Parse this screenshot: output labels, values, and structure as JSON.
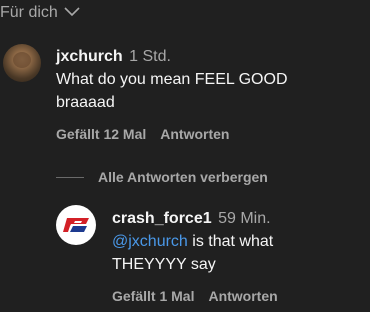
{
  "filter": {
    "label": "Für dich",
    "icon": "chevron-down-icon"
  },
  "comments": [
    {
      "username": "jxchurch",
      "time": "1 Std.",
      "text": "What do you mean FEEL GOOD braaaad",
      "likes_label": "Gefällt 12 Mal",
      "reply_label": "Antworten"
    }
  ],
  "replies_toggle": {
    "label": "Alle Antworten verbergen"
  },
  "replies": [
    {
      "username": "crash_force1",
      "time": "59 Min.",
      "mention": "@jxchurch",
      "text": "is that what THEYYYY say",
      "likes_label": "Gefällt 1 Mal",
      "reply_label": "Antworten"
    }
  ],
  "colors": {
    "background": "#202020",
    "mention": "#4a98e8",
    "logo_red": "#d32027",
    "logo_blue": "#1d3a8f"
  }
}
